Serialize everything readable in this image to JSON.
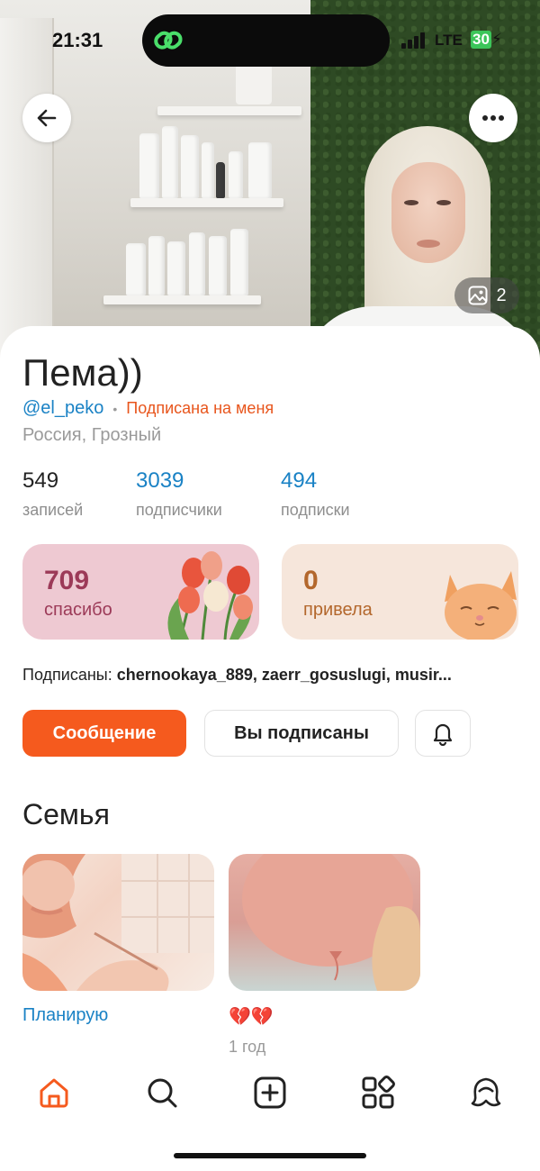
{
  "status_bar": {
    "time": "21:31",
    "network": "LTE",
    "battery": "30"
  },
  "hero": {
    "photo_count": "2"
  },
  "profile": {
    "name": "Пема))",
    "handle": "@el_peko",
    "follows_me": "Подписана на меня",
    "location": "Россия, Грозный"
  },
  "stats": [
    {
      "value": "549",
      "label": "записей"
    },
    {
      "value": "3039",
      "label": "подписчики"
    },
    {
      "value": "494",
      "label": "подписки"
    }
  ],
  "tiles": {
    "thanks": {
      "value": "709",
      "label": "спасибо"
    },
    "brought": {
      "value": "0",
      "label": "привела"
    }
  },
  "subscribed": {
    "prefix": "Подписаны:",
    "names": "chernookaya_889, zaerr_gosuslugi, musir..."
  },
  "actions": {
    "message": "Сообщение",
    "subscribed": "Вы подписаны"
  },
  "section": {
    "title": "Семья"
  },
  "albums": [
    {
      "title": "Планирую",
      "date": ""
    },
    {
      "title": "💔💔",
      "date": "1 год"
    }
  ],
  "colors": {
    "accent": "#f55a1e",
    "link": "#1a82c5",
    "thanks_tile": "#eec9d2",
    "brought_tile": "#f6e6db"
  },
  "tabs": [
    "home-icon",
    "search-icon",
    "add-icon",
    "services-icon",
    "profile-icon"
  ]
}
